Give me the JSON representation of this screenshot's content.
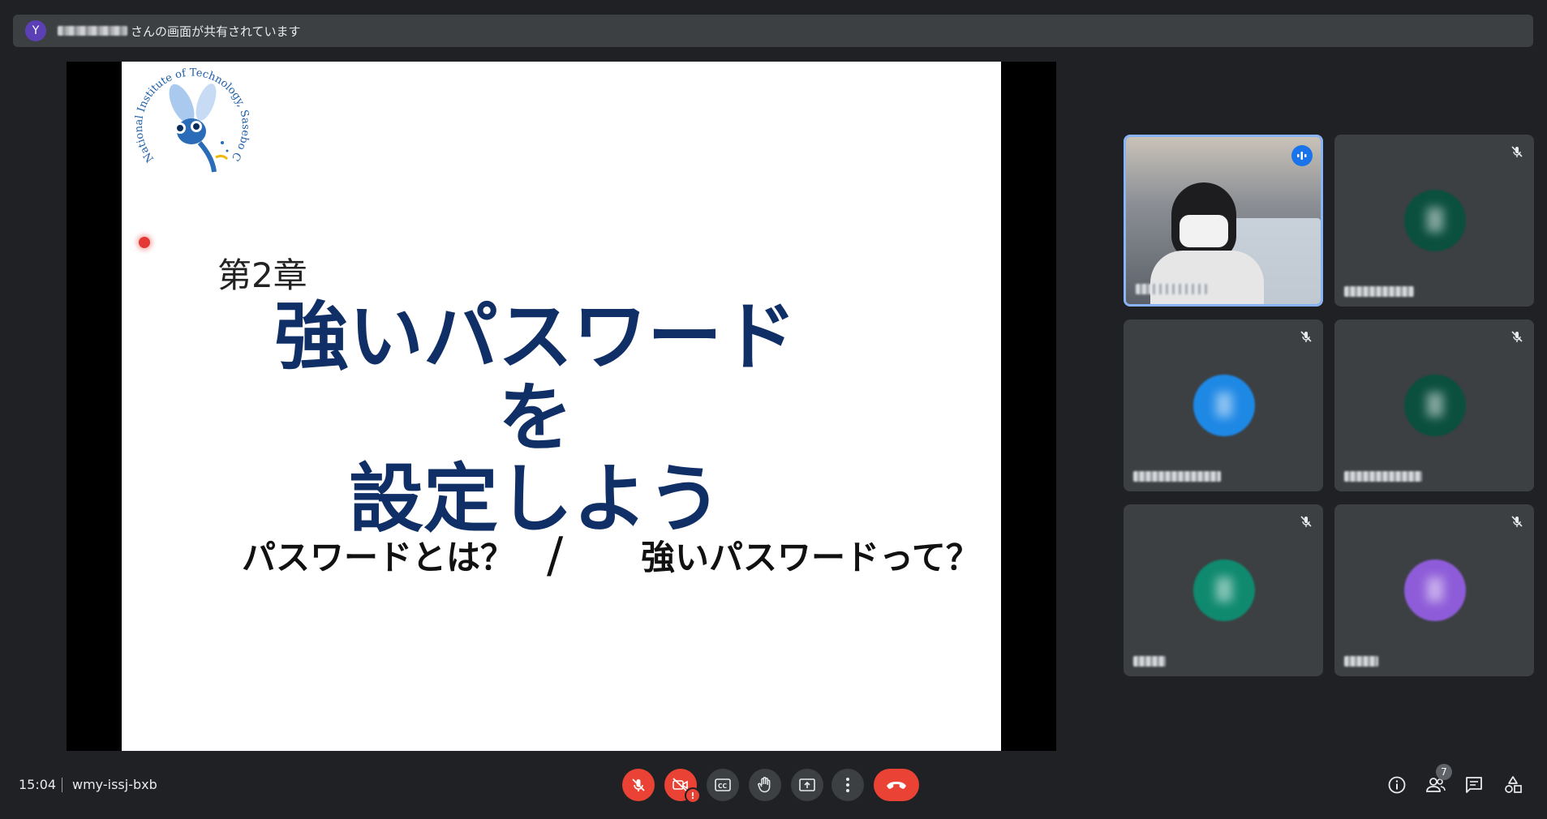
{
  "banner": {
    "avatar_initial": "Y",
    "share_text": "さんの画面が共有されています"
  },
  "slide": {
    "logo_text": "National Institute of Technology, Sasebo College",
    "chapter": "第2章",
    "title_line1": "強いパスワードを",
    "title_line2": "設定しよう",
    "sub_left": "パスワードとは？",
    "slash": "/",
    "sub_right": "強いパスワードって？"
  },
  "participants": [
    {
      "color": "#1a73e8",
      "speaking": true
    },
    {
      "color": "#0b4f3f",
      "muted": true
    },
    {
      "color": "#1e88e5",
      "muted": true
    },
    {
      "color": "#0b4f3f",
      "muted": true
    },
    {
      "color": "#0f8a6f",
      "muted": true
    },
    {
      "color": "#8e5cd9",
      "muted": true
    }
  ],
  "bottom_bar": {
    "time": "15:04",
    "meeting_code": "wmy-issj-bxb",
    "people_count": "7",
    "warning_glyph": "!"
  },
  "colors": {
    "background": "#202124",
    "surface": "#3c4043",
    "danger": "#ea4335",
    "accent": "#8ab4f8"
  }
}
